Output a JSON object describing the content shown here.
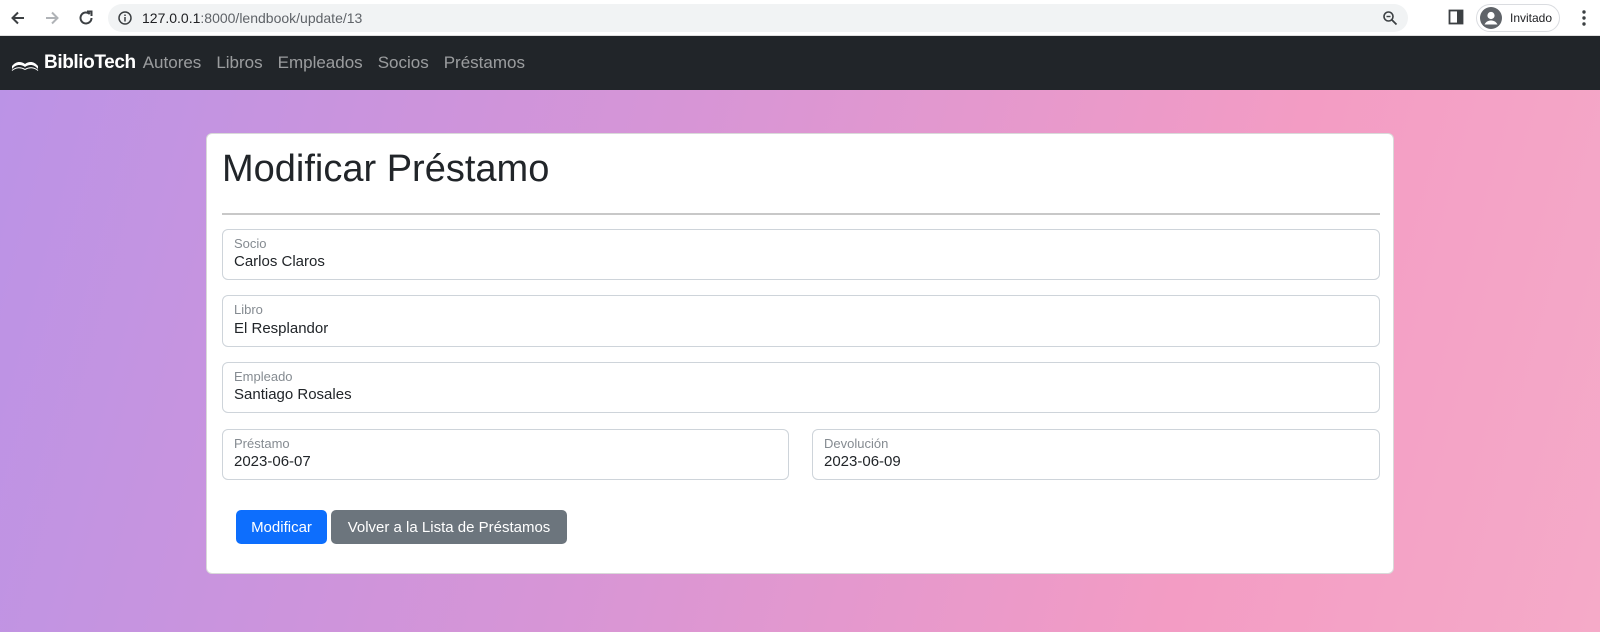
{
  "browser": {
    "url_host": "127.0.0.1",
    "url_path": ":8000/lendbook/update/13",
    "profile_label": "Invitado"
  },
  "navbar": {
    "brand": "BiblioTech",
    "links": [
      "Autores",
      "Libros",
      "Empleados",
      "Socios",
      "Préstamos"
    ]
  },
  "form": {
    "title": "Modificar Préstamo",
    "fields": {
      "socio": {
        "label": "Socio",
        "value": "Carlos Claros"
      },
      "libro": {
        "label": "Libro",
        "value": "El Resplandor"
      },
      "empleado": {
        "label": "Empleado",
        "value": "Santiago Rosales"
      },
      "prestamo": {
        "label": "Préstamo",
        "value": "2023-06-07"
      },
      "devolucion": {
        "label": "Devolución",
        "value": "2023-06-09"
      }
    },
    "submit_label": "Modificar",
    "back_label": "Volver a la Lista de Préstamos"
  },
  "colors": {
    "navbar_bg": "#212529",
    "primary": "#0d6efd",
    "secondary": "#6c757d",
    "gradient_start": "#bb93e6",
    "gradient_end": "#f5aac8"
  }
}
